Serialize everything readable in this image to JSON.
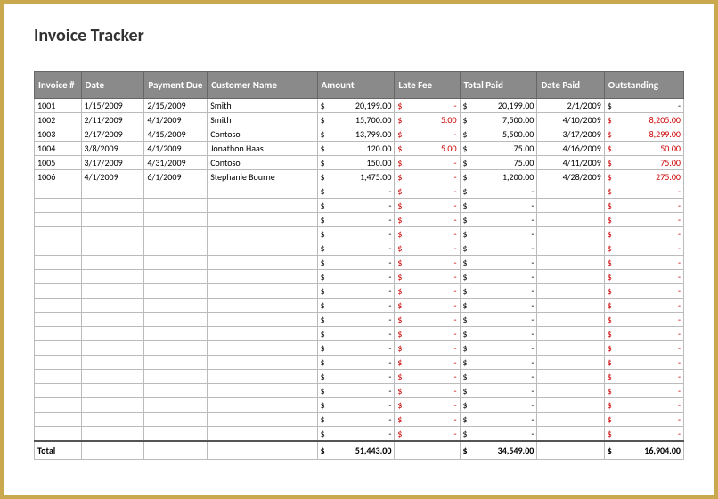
{
  "title": "Invoice Tracker",
  "headers": {
    "invoice": "Invoice #",
    "date": "Date",
    "paymentDue": "Payment Due",
    "customer": "Customer Name",
    "amount": "Amount",
    "lateFee": "Late Fee",
    "totalPaid": "Total Paid",
    "datePaid": "Date Paid",
    "outstanding": "Outstanding"
  },
  "rows": [
    {
      "invoice": "1001",
      "date": "1/15/2009",
      "paymentDue": "2/15/2009",
      "customer": "Smith",
      "amount": "20,199.00",
      "lateFee": "-",
      "totalPaid": "20,199.00",
      "datePaid": "2/1/2009",
      "outstanding": "-"
    },
    {
      "invoice": "1002",
      "date": "2/11/2009",
      "paymentDue": "4/1/2009",
      "customer": "Smith",
      "amount": "15,700.00",
      "lateFee": "5.00",
      "totalPaid": "7,500.00",
      "datePaid": "4/10/2009",
      "outstanding": "8,205.00"
    },
    {
      "invoice": "1003",
      "date": "2/17/2009",
      "paymentDue": "4/15/2009",
      "customer": "Contoso",
      "amount": "13,799.00",
      "lateFee": "-",
      "totalPaid": "5,500.00",
      "datePaid": "3/17/2009",
      "outstanding": "8,299.00"
    },
    {
      "invoice": "1004",
      "date": "3/8/2009",
      "paymentDue": "4/1/2009",
      "customer": "Jonathon Haas",
      "amount": "120.00",
      "lateFee": "5.00",
      "totalPaid": "75.00",
      "datePaid": "4/16/2009",
      "outstanding": "50.00"
    },
    {
      "invoice": "1005",
      "date": "3/17/2009",
      "paymentDue": "4/31/2009",
      "customer": "Contoso",
      "amount": "150.00",
      "lateFee": "-",
      "totalPaid": "75.00",
      "datePaid": "4/11/2009",
      "outstanding": "75.00"
    },
    {
      "invoice": "1006",
      "date": "4/1/2009",
      "paymentDue": "6/1/2009",
      "customer": "Stephanie Bourne",
      "amount": "1,475.00",
      "lateFee": "-",
      "totalPaid": "1,200.00",
      "datePaid": "4/28/2009",
      "outstanding": "275.00"
    }
  ],
  "emptyRowCount": 18,
  "totals": {
    "label": "Total",
    "amount": "51,443.00",
    "totalPaid": "34,549.00",
    "outstanding": "16,904.00"
  }
}
